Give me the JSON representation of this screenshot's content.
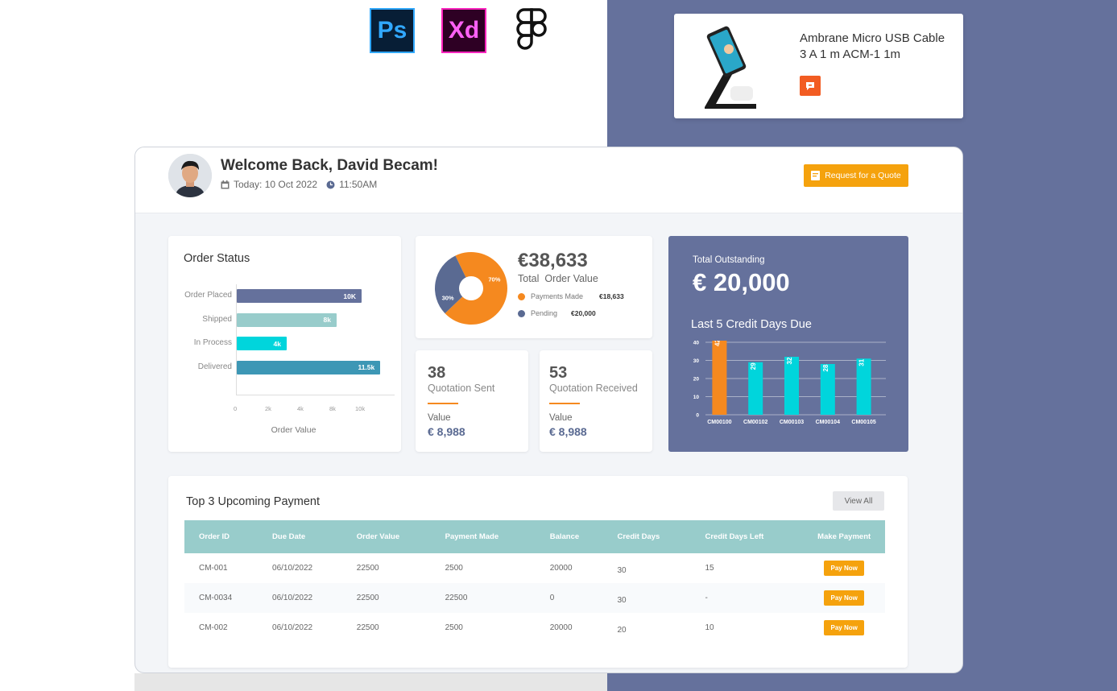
{
  "tools": {
    "ps": "Ps",
    "xd": "Xd"
  },
  "product": {
    "name": "Ambrane Micro USB Cable 3 A 1 m ACM-1 1m"
  },
  "header": {
    "welcome": "Welcome Back, David Becam!",
    "date": "Today: 10 Oct 2022",
    "time": "11:50AM",
    "quote_button": "Request for a Quote"
  },
  "order_status": {
    "title": "Order Status",
    "xlabel": "Order Value",
    "bars": [
      {
        "label": "Order Placed",
        "value": 10000,
        "display": "10K",
        "color": "#65719c"
      },
      {
        "label": "Shipped",
        "value": 8000,
        "display": "8k",
        "color": "#98cccb"
      },
      {
        "label": "In Process",
        "value": 4000,
        "display": "4k",
        "color": "#00d5dc"
      },
      {
        "label": "Delivered",
        "value": 11500,
        "display": "11.5k",
        "color": "#3d97b5"
      }
    ],
    "ticks": [
      "0",
      "2k",
      "4k",
      "8k",
      "10k"
    ]
  },
  "order_value": {
    "amount": "€38,633",
    "label": "Total  Order Value",
    "legend": [
      {
        "label": "Payments Made",
        "value": "€18,633",
        "color": "#f5891f"
      },
      {
        "label": "Pending",
        "value": "€20,000",
        "color": "#5a6a92"
      }
    ],
    "pie": [
      {
        "label": "70%",
        "value": 70,
        "color": "#f5891f"
      },
      {
        "label": "30%",
        "value": 30,
        "color": "#5a6a92"
      }
    ]
  },
  "quotation_sent": {
    "count": "38",
    "label": "Quotation Sent",
    "value_label": "Value",
    "value": "€ 8,988"
  },
  "quotation_received": {
    "count": "53",
    "label": "Quotation Received",
    "value_label": "Value",
    "value": "€ 8,988"
  },
  "outstanding": {
    "label": "Total Outstanding",
    "amount": "€ 20,000",
    "chart_title": "Last 5 Credit Days Due"
  },
  "chart_data": {
    "type": "bar",
    "title": "Last 5 Credit Days Due",
    "categories": [
      "CM00100",
      "CM00102",
      "CM00103",
      "CM00104",
      "CM00105"
    ],
    "values": [
      42,
      29,
      32,
      28,
      31
    ],
    "colors": [
      "#f5891f",
      "#00d5dc",
      "#00d5dc",
      "#00d5dc",
      "#00d5dc"
    ],
    "yticks": [
      0,
      10,
      20,
      30,
      40
    ],
    "ylim": [
      0,
      40
    ],
    "grid": true
  },
  "payments": {
    "title": "Top 3 Upcoming Payment",
    "view_all": "View All",
    "columns": [
      "Order ID",
      "Due Date",
      "Order Value",
      "Payment Made",
      "Balance",
      "Credit Days",
      "Credit Days Left",
      "Make Payment"
    ],
    "rows": [
      {
        "id": "CM-001",
        "due": "06/10/2022",
        "order_value": "22500",
        "paid": "2500",
        "balance": "20000",
        "credit_days": "30",
        "days_left": "15",
        "action": "Pay Now"
      },
      {
        "id": "CM-0034",
        "due": "06/10/2022",
        "order_value": "22500",
        "paid": "22500",
        "balance": "0",
        "credit_days": "30",
        "days_left": "-",
        "action": "Pay Now"
      },
      {
        "id": "CM-002",
        "due": "06/10/2022",
        "order_value": "22500",
        "paid": "2500",
        "balance": "20000",
        "credit_days": "20",
        "days_left": "10",
        "action": "Pay Now"
      }
    ]
  }
}
